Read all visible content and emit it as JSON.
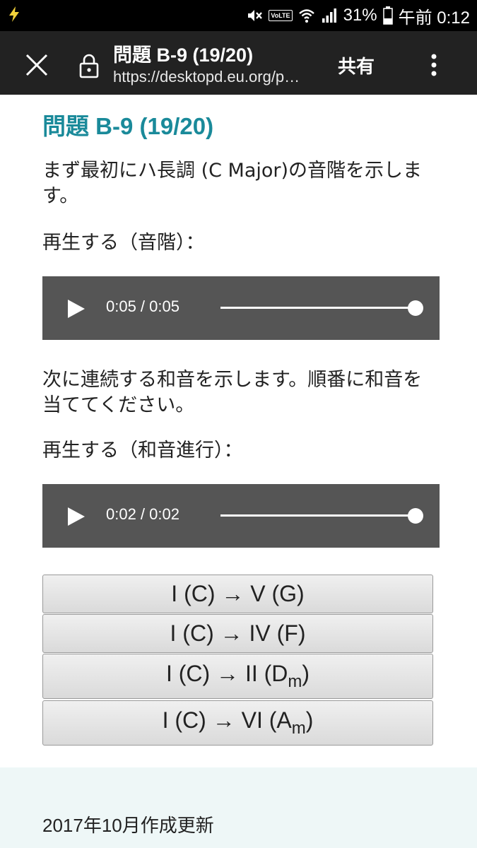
{
  "status_bar": {
    "battery": "31%",
    "time": "午前 0:12",
    "volte": "VoLTE",
    "icons": [
      "charging-bolt-icon",
      "mute-icon",
      "wifi-icon",
      "signal-icon",
      "battery-icon"
    ]
  },
  "toolbar": {
    "title": "問題 B-9 (19/20)",
    "url": "https://desktopd.eu.org/p…",
    "share_label": "共有"
  },
  "main": {
    "heading": "問題 B-9 (19/20)",
    "intro": "まず最初にハ長調 (C Major)の音階を示します。",
    "play_scale_label": "再生する（音階）：",
    "player1": {
      "time": "0:05 / 0:05",
      "progress": 1.0
    },
    "chords_intro": "次に連続する和音を示します。順番に和音を当ててください。",
    "play_chords_label": "再生する（和音進行）：",
    "player2": {
      "time": "0:02 / 0:02",
      "progress": 1.0
    },
    "choices": [
      {
        "text": "I (C) → V (G)",
        "sub": "",
        "tail": ""
      },
      {
        "text": "I (C) → IV (F)",
        "sub": "",
        "tail": ""
      },
      {
        "text": "I (C) → II (D",
        "sub": "m",
        "tail": ")"
      },
      {
        "text": "I (C) → VI (A",
        "sub": "m",
        "tail": ")"
      }
    ]
  },
  "footer": {
    "text": "2017年10月作成更新"
  },
  "colors": {
    "heading": "#1a8a9a",
    "toolbar": "#222222",
    "player": "#555555",
    "footer_bg": "#eef7f7"
  }
}
